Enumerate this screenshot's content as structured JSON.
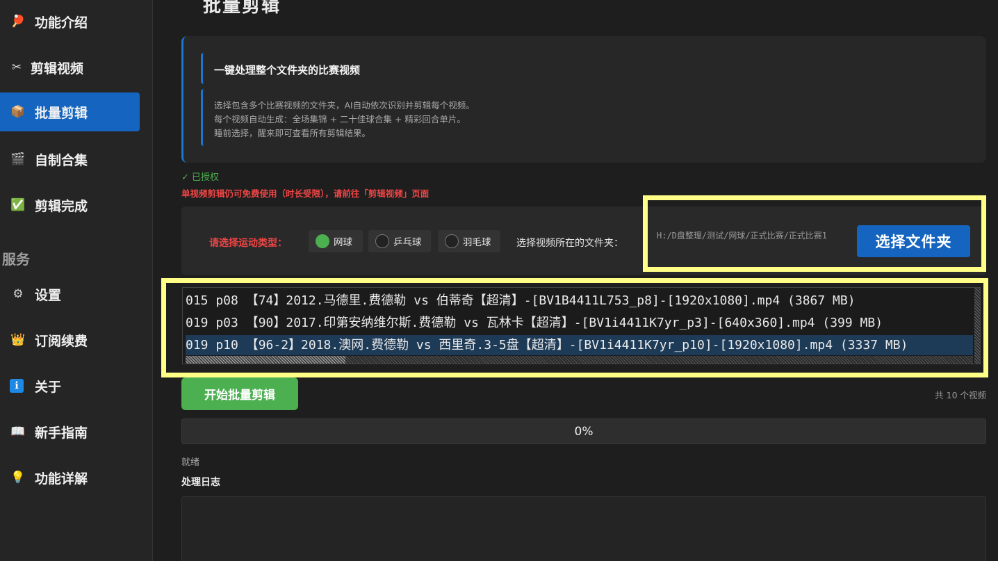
{
  "sidebar": {
    "items": [
      {
        "label": "功能介绍",
        "icon": "ping-pong-paddle-icon",
        "glyph": "🏓"
      },
      {
        "label": "剪辑视频",
        "icon": "scissors-icon",
        "glyph": "✂"
      },
      {
        "label": "批量剪辑",
        "icon": "package-icon",
        "glyph": "📦"
      },
      {
        "label": "自制合集",
        "icon": "clapperboard-icon",
        "glyph": "🎬"
      },
      {
        "label": "剪辑完成",
        "icon": "check-mark-icon",
        "glyph": "✅"
      }
    ],
    "section_label": "服务",
    "service_items": [
      {
        "label": "设置",
        "icon": "gear-icon",
        "glyph": "⚙"
      },
      {
        "label": "订阅续费",
        "icon": "crown-icon",
        "glyph": "👑"
      },
      {
        "label": "关于",
        "icon": "info-icon",
        "glyph": "ℹ"
      },
      {
        "label": "新手指南",
        "icon": "book-icon",
        "glyph": "📖"
      },
      {
        "label": "功能详解",
        "icon": "light-bulb-icon",
        "glyph": "💡"
      }
    ],
    "active_item": "批量剪辑"
  },
  "page": {
    "title": "批量剪辑"
  },
  "intro": {
    "title": "一键处理整个文件夹的比赛视频",
    "lines": [
      "选择包含多个比赛视频的文件夹，AI自动依次识别并剪辑每个视频。",
      "每个视频自动生成：全场集锦 + 二十佳球合集 + 精彩回合单片。",
      "睡前选择，醒来即可查看所有剪辑结果。"
    ]
  },
  "license": {
    "status": "✓  已授权",
    "warning": "单视频剪辑仍可免费使用（时长受限），请前往「剪辑视频」页面"
  },
  "controls": {
    "sport_label": "请选择运动类型：",
    "sports": [
      {
        "label": "网球",
        "checked": true
      },
      {
        "label": "乒乓球",
        "checked": false
      },
      {
        "label": "羽毛球",
        "checked": false
      }
    ],
    "folder_label": "选择视频所在的文件夹：",
    "folder_path": "H:/D盘整理/测试/网球/正式比赛/正式比赛1",
    "choose_button": "选择文件夹"
  },
  "files": [
    {
      "name": "015 p08 【74】2012.马德里.费德勒 vs 伯蒂奇【超清】-[BV1B4411L753_p8]-[1920x1080].mp4  (3867 MB)",
      "selected": false
    },
    {
      "name": "019 p03 【90】2017.印第安纳维尔斯.费德勒 vs 瓦林卡【超清】-[BV1i4411K7yr_p3]-[640x360].mp4  (399 MB)",
      "selected": false
    },
    {
      "name": "019 p10 【96-2】2018.澳网.费德勒 vs 西里奇.3-5盘【超清】-[BV1i4411K7yr_p10]-[1920x1080].mp4  (3337 MB)",
      "selected": true
    }
  ],
  "actions": {
    "start_button": "开始批量剪辑",
    "count_text": "共 10 个视频"
  },
  "progress": {
    "value": 0,
    "text": "0%"
  },
  "status": {
    "text": "就绪"
  },
  "log": {
    "title": "处理日志"
  },
  "colors": {
    "accent_blue": "#1565c0",
    "accent_green": "#4caf50",
    "warning_red": "#ef4545",
    "highlight_yellow": "#ffff88"
  }
}
